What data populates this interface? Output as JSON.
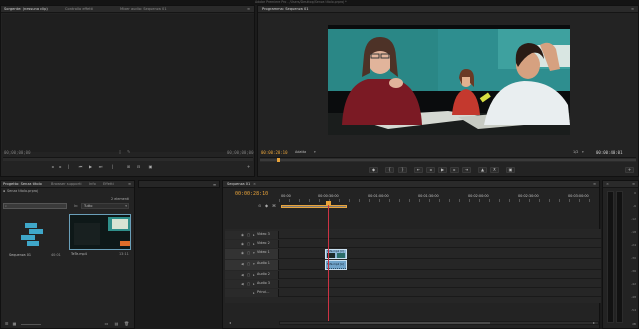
{
  "window_title": "Adobe Premiere Pro - /Users/Desktop/Senza titolo.prproj *",
  "source_panel": {
    "tabs": [
      "Sorgente: (nessuna clip)",
      "Controllo effetti",
      "Mixer audio: Sequenza 01"
    ],
    "timecode_left": "00;00;00;00",
    "timecode_right": "00;00;00;00"
  },
  "program_panel": {
    "tab": "Programma: Sequenza 01",
    "timecode_current": "00:00:28:10",
    "fit_label": "Adatta",
    "zoom_label": "1/2",
    "timecode_duration": "00:00:40:01"
  },
  "project_panel": {
    "tabs": [
      "Progetto: Senza titolo",
      "Browser supporti",
      "Info",
      "Effetti"
    ],
    "project_file": "Senza titolo.prproj",
    "item_count": "2 elementi",
    "in_label": "In:",
    "in_value": "Tutto",
    "items": [
      {
        "name": "Sequenza 01",
        "duration": "40:01"
      },
      {
        "name": "TeTe.mp4",
        "duration": "13:11"
      }
    ]
  },
  "timeline_panel": {
    "tab": "Sequenza 01",
    "timecode": "00:00:28:10",
    "ruler_labels": [
      "00:00",
      "00:00:30:00",
      "00:01:00:00",
      "00:01:30:00",
      "00:02:00:00",
      "00:02:30:00",
      "00:03:00:00"
    ],
    "tracks": [
      {
        "name": "Video 3",
        "kind": "video"
      },
      {
        "name": "Video 2",
        "kind": "video"
      },
      {
        "name": "Video 1",
        "kind": "video"
      },
      {
        "name": "Audio 1",
        "kind": "audio"
      },
      {
        "name": "Audio 2",
        "kind": "audio"
      },
      {
        "name": "Audio 3",
        "kind": "audio"
      },
      {
        "name": "Princi...",
        "kind": "master"
      }
    ],
    "video_clip_label": "TeTe.mp4 [V]",
    "audio_clip_label": "TeTe.mp4 [A]"
  },
  "audio_meter": {
    "labels": [
      "0",
      "-6",
      "-12",
      "-18",
      "-24",
      "-30",
      "-36",
      "-42",
      "-48",
      "-54"
    ],
    "bottom": "dB"
  },
  "colors": {
    "accent_orange": "#e8a33a",
    "playhead_red": "#cc3344",
    "clip_blue": "#6fa3c9",
    "panel_bg": "#232323"
  }
}
